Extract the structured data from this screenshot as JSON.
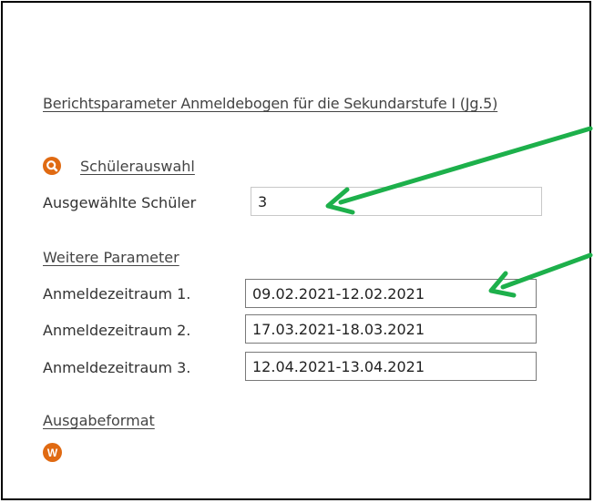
{
  "report": {
    "title": "Berichtsparameter Anmeldebogen für die Sekundarstufe I (Jg.5)"
  },
  "student_selection": {
    "icon": "search-icon",
    "link_label": "Schülerauswahl",
    "selected_label": "Ausgewählte Schüler",
    "selected_value": "3"
  },
  "parameters": {
    "heading": "Weitere Parameter",
    "fields": [
      {
        "label": "Anmeldezeitraum 1.",
        "value": "09.02.2021-12.02.2021"
      },
      {
        "label": "Anmeldezeitraum 2.",
        "value": "17.03.2021-18.03.2021"
      },
      {
        "label": "Anmeldezeitraum 3.",
        "value": "12.04.2021-13.04.2021"
      }
    ]
  },
  "output": {
    "heading": "Ausgabeformat",
    "icon": "word-icon",
    "icon_letter": "W"
  },
  "colors": {
    "accent_orange": "#E06A12",
    "annotation_green": "#1DB04B",
    "frame_border": "#000000"
  }
}
